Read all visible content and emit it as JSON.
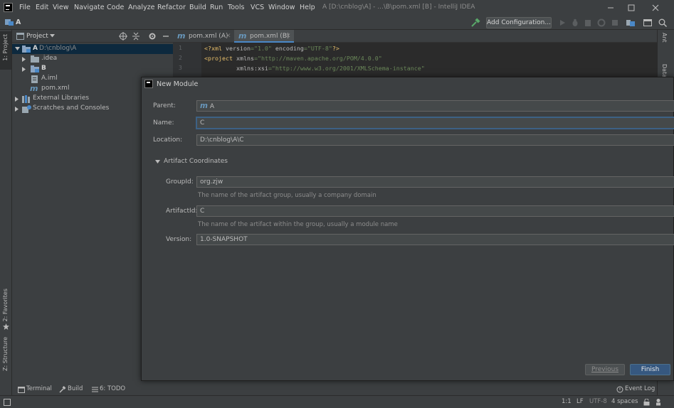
{
  "menu": [
    "File",
    "Edit",
    "View",
    "Navigate",
    "Code",
    "Analyze",
    "Refactor",
    "Build",
    "Run",
    "Tools",
    "VCS",
    "Window",
    "Help"
  ],
  "window_title": "A [D:\\cnblog\\A] - ...\\B\\pom.xml [B] - IntelliJ IDEA",
  "nav_crumb": "A",
  "toolbar": {
    "add_config": "Add Configuration..."
  },
  "left_strip": {
    "project": "1: Project",
    "favorites": "2: Favorites",
    "structure": "Z: Structure"
  },
  "right_strip": {
    "ant": "Ant",
    "database": "Database"
  },
  "project_panel": {
    "title": "Project",
    "tree": [
      {
        "label": "A",
        "extra": "D:\\cnblog\\A",
        "icon": "module-folder-icon"
      },
      {
        "label": ".idea",
        "icon": "folder-icon"
      },
      {
        "label": "B",
        "icon": "module-folder-icon"
      },
      {
        "label": "A.iml",
        "icon": "iml-file-icon"
      },
      {
        "label": "pom.xml",
        "icon": "maven-file-icon"
      },
      {
        "label": "External Libraries",
        "icon": "library-icon"
      },
      {
        "label": "Scratches and Consoles",
        "icon": "scratches-icon"
      }
    ]
  },
  "editor": {
    "tabs": [
      {
        "label": "pom.xml (A)",
        "active": false
      },
      {
        "label": "pom.xml (B)",
        "active": true
      }
    ],
    "lines": [
      {
        "num": "1",
        "tag": "<?xml ",
        "a1": "version",
        "v1": "=\"1.0\" ",
        "a2": "encoding",
        "v2": "=\"UTF-8\"",
        "end": "?>"
      },
      {
        "num": "2",
        "tag": "<project ",
        "a1": "xmlns",
        "v1": "=\"http://maven.apache.org/POM/4.0.0\"",
        "a2": "",
        "v2": "",
        "end": ""
      },
      {
        "num": "3",
        "tag": "         ",
        "a1": "xmlns:xsi",
        "v1": "=\"http://www.w3.org/2001/XMLSchema-instance\"",
        "a2": "",
        "v2": "",
        "end": ""
      }
    ]
  },
  "dialog": {
    "title": "New Module",
    "parent_label": "Parent:",
    "parent_value": "A",
    "name_label": "Name:",
    "name_value": "C",
    "location_label": "Location:",
    "location_value": "D:\\cnblog\\A\\C",
    "artifact_section": "Artifact Coordinates",
    "groupid_label": "GroupId:",
    "groupid_value": "org.zjw",
    "groupid_hint": "The name of the artifact group, usually a company domain",
    "artifactid_label": "ArtifactId:",
    "artifactid_value": "C",
    "artifactid_hint": "The name of the artifact within the group, usually a module name",
    "version_label": "Version:",
    "version_value": "1.0-SNAPSHOT",
    "previous": "Previous",
    "finish": "Finish"
  },
  "bottom_tools": {
    "terminal": "Terminal",
    "build": "Build",
    "todo": "6: TODO",
    "event_log": "Event Log"
  },
  "status": {
    "position": "1:1",
    "line_sep": "LF",
    "encoding": "UTF-8",
    "indent": "4 spaces"
  },
  "colors": {
    "bg": "#3c3f41",
    "editor_bg": "#2b2b2b",
    "accent": "#4a88c7",
    "finish_button": "#365880"
  }
}
